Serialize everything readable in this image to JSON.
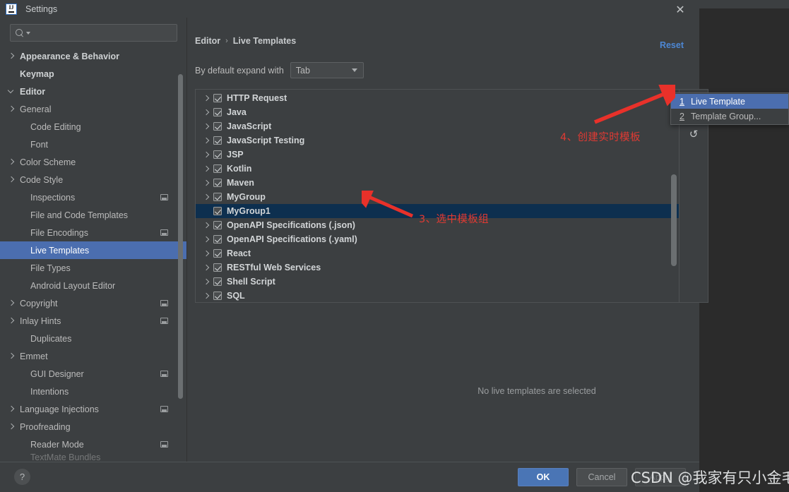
{
  "window": {
    "title": "Settings",
    "app_icon": "intellij-idea-icon",
    "close_icon": "close-icon"
  },
  "search": {
    "value": "",
    "placeholder": "",
    "icon": "search-icon"
  },
  "sidebar": {
    "scrollbar": "sidebar-scrollbar",
    "items": [
      {
        "label": "Appearance & Behavior",
        "level": 0,
        "arrow": "right",
        "badge": false,
        "selected": false
      },
      {
        "label": "Keymap",
        "level": 0,
        "arrow": "none",
        "badge": false,
        "selected": false
      },
      {
        "label": "Editor",
        "level": 0,
        "arrow": "down",
        "badge": false,
        "selected": false
      },
      {
        "label": "General",
        "level": 1,
        "arrow": "right",
        "badge": false,
        "selected": false
      },
      {
        "label": "Code Editing",
        "level": 1,
        "arrow": "none",
        "badge": false,
        "selected": false
      },
      {
        "label": "Font",
        "level": 1,
        "arrow": "none",
        "badge": false,
        "selected": false
      },
      {
        "label": "Color Scheme",
        "level": 1,
        "arrow": "right",
        "badge": false,
        "selected": false
      },
      {
        "label": "Code Style",
        "level": 1,
        "arrow": "right",
        "badge": false,
        "selected": false
      },
      {
        "label": "Inspections",
        "level": 1,
        "arrow": "none",
        "badge": true,
        "selected": false
      },
      {
        "label": "File and Code Templates",
        "level": 1,
        "arrow": "none",
        "badge": false,
        "selected": false
      },
      {
        "label": "File Encodings",
        "level": 1,
        "arrow": "none",
        "badge": true,
        "selected": false
      },
      {
        "label": "Live Templates",
        "level": 1,
        "arrow": "none",
        "badge": false,
        "selected": true
      },
      {
        "label": "File Types",
        "level": 1,
        "arrow": "none",
        "badge": false,
        "selected": false
      },
      {
        "label": "Android Layout Editor",
        "level": 1,
        "arrow": "none",
        "badge": false,
        "selected": false
      },
      {
        "label": "Copyright",
        "level": 1,
        "arrow": "right",
        "badge": true,
        "selected": false
      },
      {
        "label": "Inlay Hints",
        "level": 1,
        "arrow": "right",
        "badge": true,
        "selected": false
      },
      {
        "label": "Duplicates",
        "level": 1,
        "arrow": "none",
        "badge": false,
        "selected": false
      },
      {
        "label": "Emmet",
        "level": 1,
        "arrow": "right",
        "badge": false,
        "selected": false
      },
      {
        "label": "GUI Designer",
        "level": 1,
        "arrow": "none",
        "badge": true,
        "selected": false
      },
      {
        "label": "Intentions",
        "level": 1,
        "arrow": "none",
        "badge": false,
        "selected": false
      },
      {
        "label": "Language Injections",
        "level": 1,
        "arrow": "right",
        "badge": true,
        "selected": false
      },
      {
        "label": "Proofreading",
        "level": 1,
        "arrow": "right",
        "badge": false,
        "selected": false
      },
      {
        "label": "Reader Mode",
        "level": 1,
        "arrow": "none",
        "badge": true,
        "selected": false
      },
      {
        "label": "TextMate Bundles",
        "level": 1,
        "arrow": "none",
        "badge": false,
        "selected": false,
        "clipped": true
      }
    ]
  },
  "content": {
    "breadcrumb": {
      "parent": "Editor",
      "separator": "›",
      "current": "Live Templates"
    },
    "reset_label": "Reset",
    "expand_with": {
      "label": "By default expand with",
      "value": "Tab",
      "caret_icon": "chevron-down-icon"
    },
    "templates": [
      {
        "label": "HTTP Request",
        "checked": true,
        "expandable": true,
        "selected": false
      },
      {
        "label": "Java",
        "checked": true,
        "expandable": true,
        "selected": false
      },
      {
        "label": "JavaScript",
        "checked": true,
        "expandable": true,
        "selected": false
      },
      {
        "label": "JavaScript Testing",
        "checked": true,
        "expandable": true,
        "selected": false
      },
      {
        "label": "JSP",
        "checked": true,
        "expandable": true,
        "selected": false
      },
      {
        "label": "Kotlin",
        "checked": true,
        "expandable": true,
        "selected": false
      },
      {
        "label": "Maven",
        "checked": true,
        "expandable": true,
        "selected": false
      },
      {
        "label": "MyGroup",
        "checked": true,
        "expandable": true,
        "selected": false
      },
      {
        "label": "MyGroup1",
        "checked": true,
        "expandable": false,
        "selected": true
      },
      {
        "label": "OpenAPI Specifications (.json)",
        "checked": true,
        "expandable": true,
        "selected": false
      },
      {
        "label": "OpenAPI Specifications (.yaml)",
        "checked": true,
        "expandable": true,
        "selected": false
      },
      {
        "label": "React",
        "checked": true,
        "expandable": true,
        "selected": false
      },
      {
        "label": "RESTful Web Services",
        "checked": true,
        "expandable": true,
        "selected": false
      },
      {
        "label": "Shell Script",
        "checked": true,
        "expandable": true,
        "selected": false
      },
      {
        "label": "SQL",
        "checked": true,
        "expandable": true,
        "selected": false
      }
    ],
    "toolbar": {
      "add_label": "+",
      "add_icon": "plus-icon",
      "revert_label": "↺",
      "revert_icon": "revert-icon"
    },
    "empty_message": "No live templates are selected"
  },
  "popup_menu": {
    "items": [
      {
        "mnemonic": "1",
        "label": "Live Template",
        "highlighted": true
      },
      {
        "mnemonic": "2",
        "label": "Template Group...",
        "highlighted": false
      }
    ]
  },
  "annotations": {
    "note_3": "3、选中模板组",
    "note_4": "4、创建实时模板",
    "color": "#e03a33"
  },
  "footer": {
    "help_label": "?",
    "ok_label": "OK",
    "cancel_label": "Cancel",
    "apply_label": "Apply"
  },
  "watermark": {
    "text": "CSDN @我家有只小金毛"
  },
  "backdrop": {
    "glyph1": "€",
    "glyph2": "€"
  },
  "colors": {
    "dialog_bg": "#3c3f41",
    "sidebar_selection": "#4b6eaf",
    "tree_selection": "#0d2f4f",
    "accent_link": "#4d87d4",
    "ok_button": "#4a75b5",
    "annotation_red": "#e03a33"
  }
}
